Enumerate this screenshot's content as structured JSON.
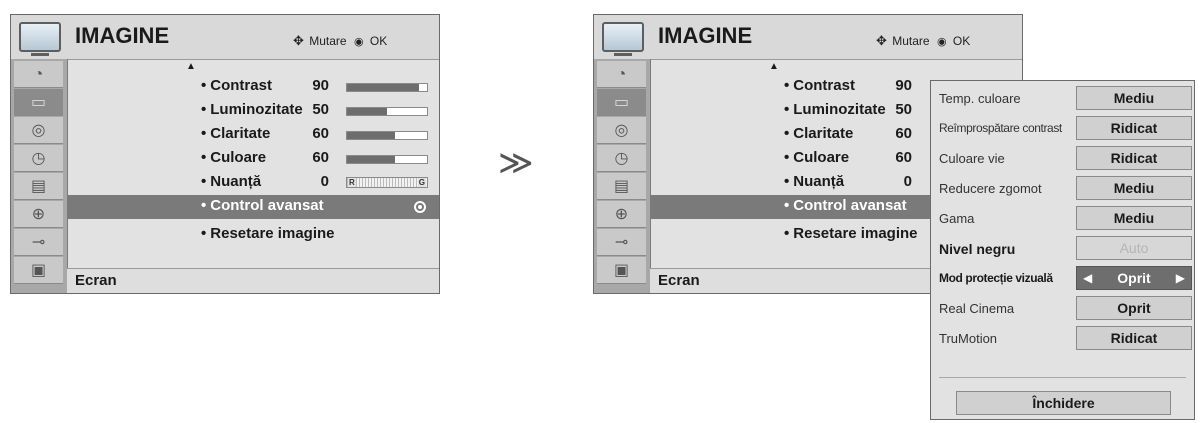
{
  "menu": {
    "title": "IMAGINE",
    "hint_move": "Mutare",
    "hint_ok": "OK",
    "footer": "Ecran",
    "items": [
      {
        "label": "Contrast",
        "value": "90",
        "level": 90
      },
      {
        "label": "Luminozitate",
        "value": "50",
        "level": 50
      },
      {
        "label": "Claritate",
        "value": "60",
        "level": 60
      },
      {
        "label": "Culoare",
        "value": "60",
        "level": 60
      },
      {
        "label": "Nuanță",
        "value": "0",
        "level": 50
      },
      {
        "label": "Control avansat"
      },
      {
        "label": "Resetare imagine"
      }
    ],
    "tint_left": "R",
    "tint_right": "G",
    "sidebar_icons": [
      "satellite-dish-icon",
      "picture-icon",
      "speaker-icon",
      "clock-icon",
      "parental-lock-icon",
      "lock-icon",
      "input-plug-icon",
      "photo-gallery-icon"
    ]
  },
  "separator": "≫",
  "submenu": {
    "rows": [
      {
        "label": "Temp. culoare",
        "value": "Mediu"
      },
      {
        "label": "Reîmprospătare contrast",
        "value": "Ridicat"
      },
      {
        "label": "Culoare vie",
        "value": "Ridicat"
      },
      {
        "label": "Reducere zgomot",
        "value": "Mediu"
      },
      {
        "label": "Gama",
        "value": "Mediu"
      },
      {
        "label": "Nivel negru",
        "value": "Auto"
      },
      {
        "label": "Mod protecție vizuală",
        "value": "Oprit"
      },
      {
        "label": "Real Cinema",
        "value": "Oprit"
      },
      {
        "label": "TruMotion",
        "value": "Ridicat"
      }
    ],
    "close_label": "Închidere"
  }
}
